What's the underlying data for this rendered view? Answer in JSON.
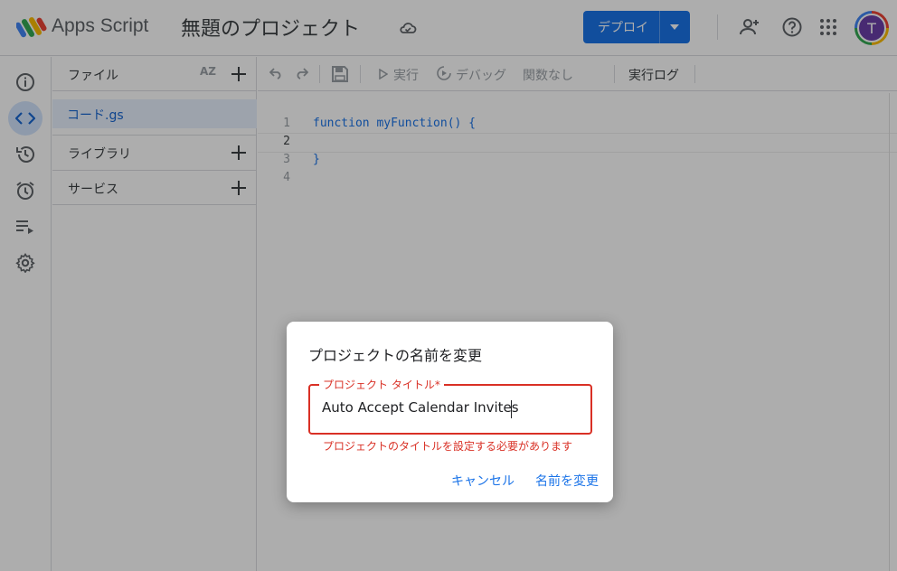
{
  "header": {
    "app_name": "Apps Script",
    "project_title": "無題のプロジェクト",
    "deploy_label": "デプロイ",
    "avatar_initial": "T"
  },
  "files_panel": {
    "title": "ファイル",
    "sort_label": "AZ",
    "files": [
      {
        "name": "コード.gs"
      }
    ],
    "sections": [
      {
        "name": "ライブラリ"
      },
      {
        "name": "サービス"
      }
    ]
  },
  "toolbar": {
    "run": "実行",
    "debug": "デバッグ",
    "no_function": "関数なし",
    "exec_log": "実行ログ"
  },
  "code": {
    "lines": [
      {
        "num": "1",
        "text": "function myFunction() {"
      },
      {
        "num": "2",
        "text": ""
      },
      {
        "num": "3",
        "text": "}"
      },
      {
        "num": "4",
        "text": ""
      }
    ]
  },
  "dialog": {
    "title": "プロジェクトの名前を変更",
    "field_label": "プロジェクト タイトル*",
    "field_value": "Auto Accept Calendar Invites",
    "error": "プロジェクトのタイトルを設定する必要があります",
    "cancel": "キャンセル",
    "rename": "名前を変更"
  },
  "colors": {
    "accent": "#1a73e8",
    "error": "#d93025",
    "active_file_bg": "#e8f0fe"
  }
}
